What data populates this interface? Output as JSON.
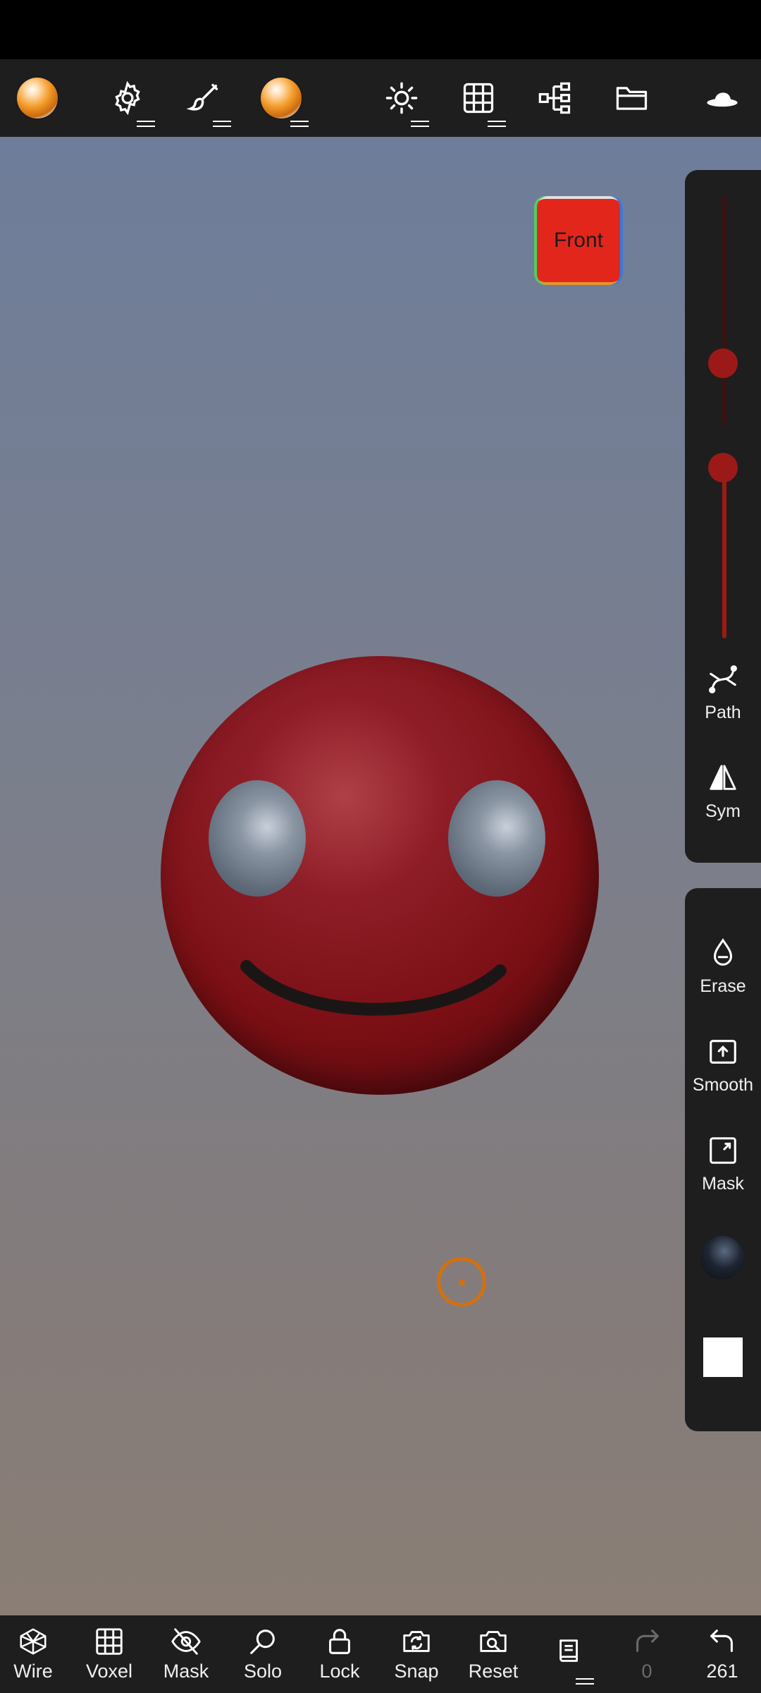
{
  "toolbar": {
    "icons": [
      "material-icon",
      "settings-icon",
      "brush-icon",
      "matcap-icon",
      "light-icon",
      "grid-icon",
      "scene-tree-icon",
      "folder-icon",
      "hat-icon"
    ]
  },
  "gizmo": {
    "label": "Front"
  },
  "right_panel_top": {
    "slider_values": {
      "radius": 0.27,
      "intensity": 0.61
    },
    "path_label": "Path",
    "sym_label": "Sym"
  },
  "right_panel_bottom": {
    "erase_label": "Erase",
    "smooth_label": "Smooth",
    "mask_label": "Mask",
    "color_swatch": "#ffffff"
  },
  "bottom_bar": {
    "wire": "Wire",
    "voxel": "Voxel",
    "mask": "Mask",
    "solo": "Solo",
    "lock": "Lock",
    "snap": "Snap",
    "reset": "Reset",
    "redo_count": "0",
    "undo_count": "261"
  },
  "colors": {
    "accent": "#d4700e",
    "slider": "#9b1a18",
    "panel": "#1e1e1e",
    "mesh": "#7a0f14"
  }
}
